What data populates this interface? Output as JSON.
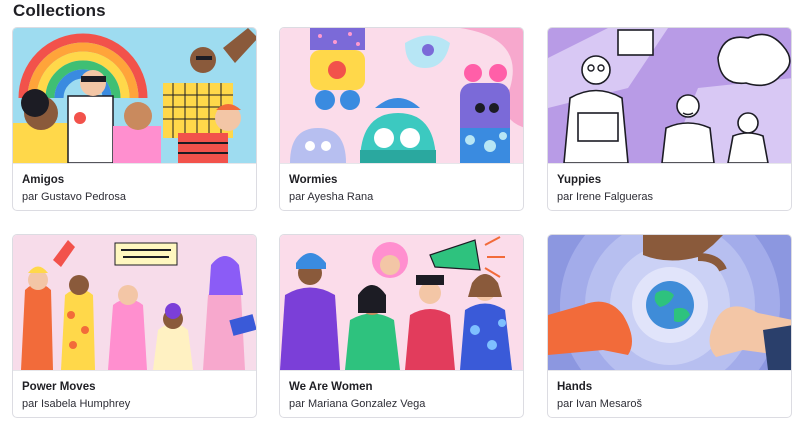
{
  "page": {
    "section_title": "Collections"
  },
  "collections": [
    {
      "title": "Amigos",
      "author": "par Gustavo Pedrosa",
      "palette": [
        "#9edcf0",
        "#ffd84a",
        "#f26b3a",
        "#1c1c24"
      ]
    },
    {
      "title": "Wormies",
      "author": "par Ayesha Rana",
      "palette": [
        "#f7c8dd",
        "#ffd84a",
        "#3cc9c0",
        "#7b6ad8"
      ]
    },
    {
      "title": "Yuppies",
      "author": "par Irene Falgueras",
      "palette": [
        "#b89be6",
        "#ffffff",
        "#1c1c24",
        "#d8c8f4"
      ]
    },
    {
      "title": "Power Moves",
      "author": "par Isabela Humphrey",
      "palette": [
        "#f4c8e0",
        "#f26b3a",
        "#8b5cf6",
        "#ffd84a"
      ]
    },
    {
      "title": "We Are Women",
      "author": "par Mariana Gonzalez Vega",
      "palette": [
        "#f7c8dd",
        "#3aa5e8",
        "#2ec27e",
        "#ff4d8d"
      ]
    },
    {
      "title": "Hands",
      "author": "par Ivan Mesaroš",
      "palette": [
        "#b7bff0",
        "#f26b3a",
        "#3f8cd8",
        "#f3c6a6"
      ]
    }
  ]
}
